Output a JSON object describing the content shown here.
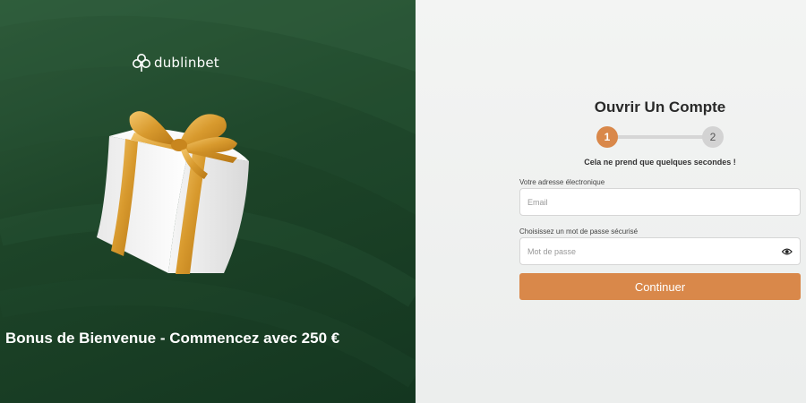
{
  "brand": {
    "name": "dublinbet",
    "accent": "#d9884a",
    "panel_green": "#1d4428"
  },
  "hero": {
    "title": "Bonus de Bienvenue - Commencez avec 250 €"
  },
  "form": {
    "title": "Ouvrir Un Compte",
    "steps": [
      "1",
      "2"
    ],
    "current_step": 1,
    "subtitle": "Cela ne prend que quelques secondes !",
    "email": {
      "label": "Votre adresse électronique",
      "placeholder": "Email",
      "value": ""
    },
    "password": {
      "label": "Choisissez un mot de passe sécurisé",
      "placeholder": "Mot de passe",
      "value": "",
      "toggle_icon": "eye-icon"
    },
    "submit_label": "Continuer"
  }
}
